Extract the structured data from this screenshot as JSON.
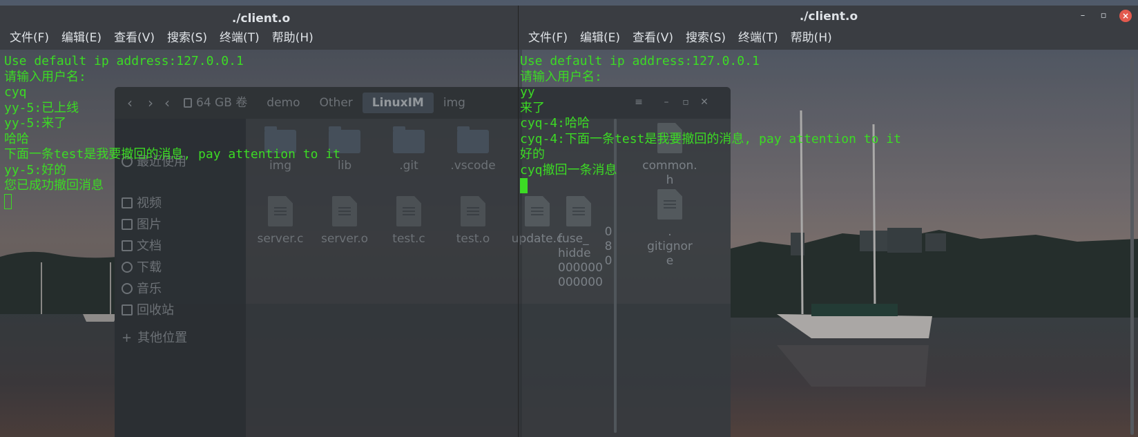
{
  "colors": {
    "terminal_text": "#3cdb24",
    "titlebar": "#3a3d42",
    "close_button": "#e25a4e",
    "focus_accent": "#3c6fb4"
  },
  "file_manager": {
    "breadcrumbs": [
      "64 GB 卷",
      "demo",
      "Other",
      "LinuxIM",
      "img"
    ],
    "active_crumb": "LinuxIM",
    "sidebar": [
      "最近使用",
      "视频",
      "图片",
      "文档",
      "下载",
      "音乐",
      "回收站",
      "其他位置"
    ],
    "files_row1": [
      "img",
      "lib",
      ".git",
      ".vscode"
    ],
    "files_row1_right": [
      "common.\nh"
    ],
    "files_row2": [
      "server.c",
      "server.o",
      "test.c",
      "test.o",
      "update.c"
    ],
    "files_row2_partial": [
      "fuse_\nhidde\n000000\n000000",
      "0\n8\n0"
    ],
    "files_row2_right": [
      ".\ngitignor\ne"
    ]
  },
  "left_terminal": {
    "title": "./client.o",
    "menu": [
      "文件(F)",
      "编辑(E)",
      "查看(V)",
      "搜索(S)",
      "终端(T)",
      "帮助(H)"
    ],
    "lines": [
      "Use default ip address:127.0.0.1",
      "请输入用户名:",
      "cyq",
      "yy-5:已上线",
      "yy-5:来了",
      "哈哈",
      "下面一条test是我要撤回的消息, pay attention to it",
      "yy-5:好的",
      "您已成功撤回消息"
    ]
  },
  "right_terminal": {
    "title": "./client.o",
    "menu": [
      "文件(F)",
      "编辑(E)",
      "查看(V)",
      "搜索(S)",
      "终端(T)",
      "帮助(H)"
    ],
    "lines": [
      "Use default ip address:127.0.0.1",
      "请输入用户名:",
      "yy",
      "来了",
      "cyq-4:哈哈",
      "cyq-4:下面一条test是我要撤回的消息, pay attention to it",
      "好的",
      "cyq撤回一条消息"
    ],
    "buttons": {
      "minimize": "–",
      "maximize": "▫",
      "close": "×"
    }
  }
}
